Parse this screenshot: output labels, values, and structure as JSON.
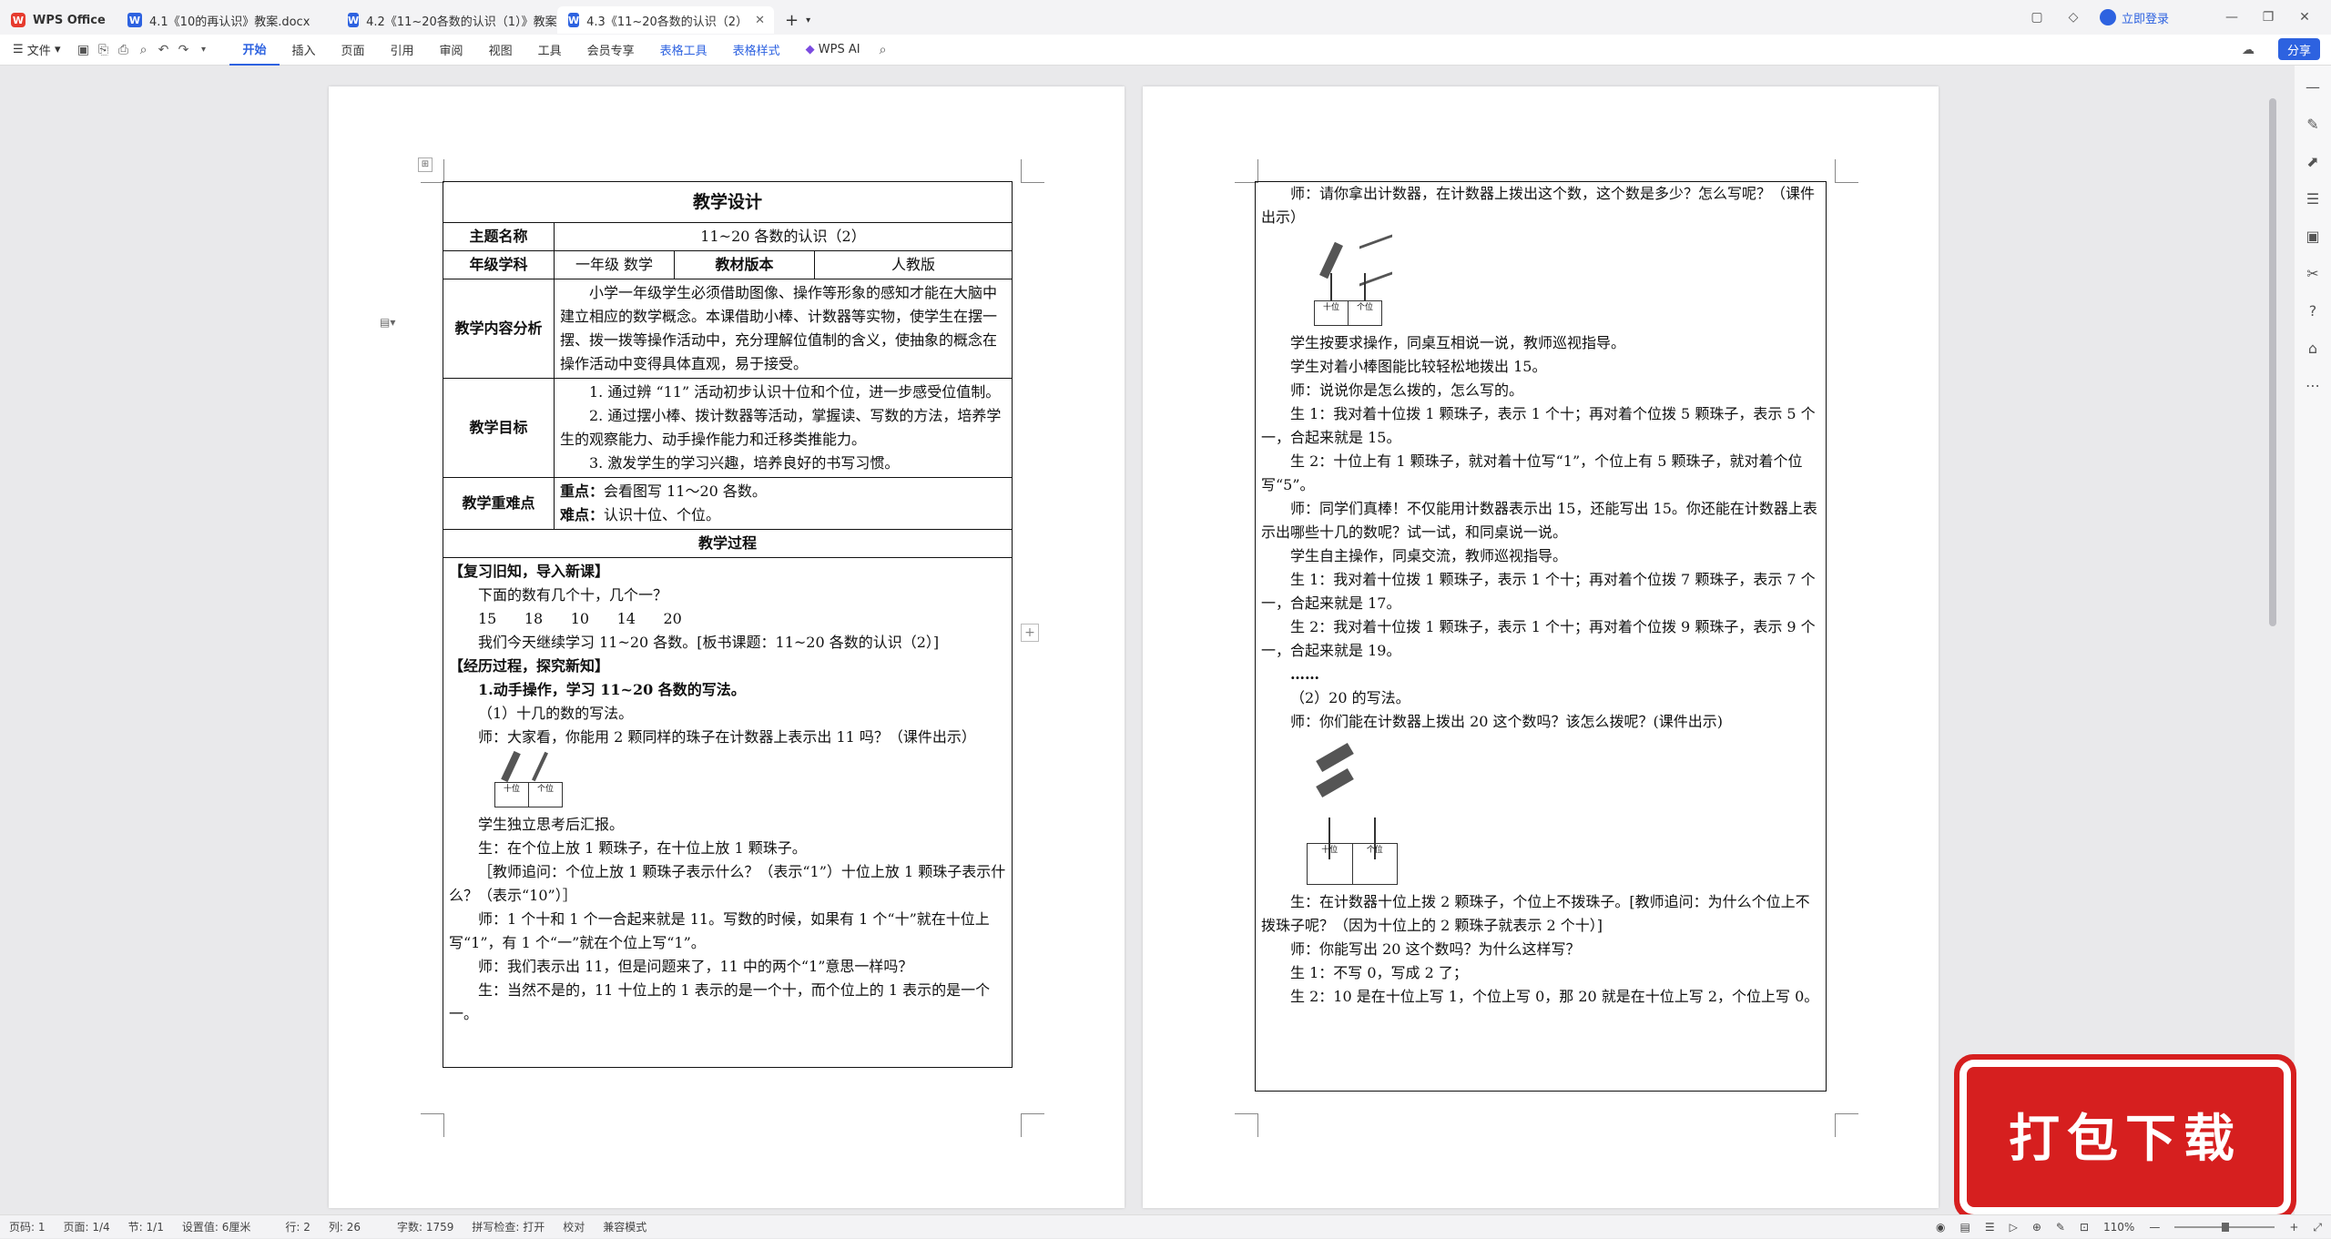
{
  "tabs": {
    "home": "WPS Office",
    "tab1": "4.1《10的再认识》教案.docx",
    "tab2": "4.2《11~20各数的认识（1）》教案",
    "tab3": "4.3《11~20各数的认识（2）",
    "add": "+"
  },
  "titlebar": {
    "login": "立即登录"
  },
  "ribbon": {
    "file": "文件",
    "menus": [
      "开始",
      "插入",
      "页面",
      "引用",
      "审阅",
      "视图",
      "工具",
      "会员专享",
      "表格工具",
      "表格样式"
    ],
    "wps_ai": "WPS AI",
    "share": "分享"
  },
  "doc": {
    "title": "教学设计",
    "topic_label": "主题名称",
    "topic_value": "11~20 各数的认识（2）",
    "grade_label": "年级学科",
    "grade_value": "一年级  数学",
    "edition_label": "教材版本",
    "edition_value": "人教版",
    "analysis_label": "教学内容分析",
    "analysis_text": "小学一年级学生必须借助图像、操作等形象的感知才能在大脑中建立相应的数学概念。本课借助小棒、计数器等实物，使学生在摆一摆、拨一拨等操作活动中，充分理解位值制的含义，使抽象的概念在操作活动中变得具体直观，易于接受。",
    "goals_label": "教学目标",
    "goal1": "1. 通过辨 “11” 活动初步认识十位和个位，进一步感受位值制。",
    "goal2": "2. 通过摆小棒、拨计数器等活动，掌握读、写数的方法，培养学生的观察能力、动手操作能力和迁移类推能力。",
    "goal3": "3. 激发学生的学习兴趣，培养良好的书写习惯。",
    "key_label": "教学重难点",
    "key_point": "重点：",
    "key_point_text": "会看图写 11～20 各数。",
    "difficulty": "难点：",
    "difficulty_text": "认识十位、个位。",
    "process_label": "教学过程",
    "p1_lines": [
      "【复习旧知，导入新课】",
      "下面的数有几个十，几个一？",
      "15      18      10      14      20",
      "我们今天继续学习 11~20 各数。[板书课题：11~20 各数的认识（2）]",
      "【经历过程，探究新知】",
      "1.动手操作，学习 11~20 各数的写法。",
      "（1）十几的数的写法。",
      "师：大家看，你能用 2 颗同样的珠子在计数器上表示出 11 吗？（课件出示）"
    ],
    "p1_lines_b": [
      "学生独立思考后汇报。",
      "生：在个位上放 1 颗珠子，在十位上放 1 颗珠子。",
      "［教师追问：个位上放 1 颗珠子表示什么？（表示“1”）十位上放 1 颗珠子表示什么？（表示“10”）］",
      "师：1 个十和 1 个一合起来就是 11。写数的时候，如果有 1 个“十”就在十位上写“1”，有 1 个“一”就在个位上写“1”。",
      "师：我们表示出 11，但是问题来了，11 中的两个“1”意思一样吗？",
      "生：当然不是的，11 十位上的 1 表示的是一个十，而个位上的 1 表示的是一个一。"
    ],
    "abacus_tens": "十位",
    "abacus_ones": "个位",
    "p2_lines_a": [
      "师：请你拿出计数器，在计数器上拨出这个数，这个数是多少？怎么写呢？（课件出示）"
    ],
    "p2_lines_b": [
      "学生按要求操作，同桌互相说一说，教师巡视指导。",
      "学生对着小棒图能比较轻松地拨出 15。",
      "师：说说你是怎么拨的，怎么写的。",
      "生 1：我对着十位拨 1 颗珠子，表示 1 个十；再对着个位拨 5 颗珠子，表示 5 个一，合起来就是 15。",
      "生 2：十位上有 1 颗珠子，就对着十位写“1”，个位上有 5 颗珠子，就对着个位写“5”。",
      "师：同学们真棒！不仅能用计数器表示出 15，还能写出 15。你还能在计数器上表示出哪些十几的数呢？试一试，和同桌说一说。",
      "学生自主操作，同桌交流，教师巡视指导。",
      "生 1：我对着十位拨 1 颗珠子，表示 1 个十；再对着个位拨 7 颗珠子，表示 7 个一，合起来就是 17。",
      "生 2：我对着十位拨 1 颗珠子，表示 1 个十；再对着个位拨 9 颗珠子，表示 9 个一，合起来就是 19。",
      "……",
      "（2）20 的写法。",
      "师：你们能在计数器上拨出 20 这个数吗？该怎么拨呢？(课件出示)"
    ],
    "p2_lines_c": [
      "生：在计数器十位上拨 2 颗珠子，个位上不拨珠子。[教师追问：为什么个位上不拨珠子呢？（因为十位上的 2 颗珠子就表示 2 个十）]",
      "师：你能写出 20 这个数吗？为什么这样写？",
      "生 1：不写 0，写成 2 了；",
      "生 2：10 是在十位上写 1，个位上写 0，那 20 就是在十位上写 2，个位上写 0。"
    ]
  },
  "status": {
    "page_num": "页码: 1",
    "pages": "页面: 1/4",
    "section": "节: 1/1",
    "setting": "设置值: 6厘米",
    "row": "行: 2",
    "col": "列: 26",
    "words": "字数: 1759",
    "spell": "拼写检查: 打开",
    "proof": "校对",
    "compat": "兼容模式",
    "zoom": "110%"
  },
  "badge": {
    "text": "打包下载"
  }
}
